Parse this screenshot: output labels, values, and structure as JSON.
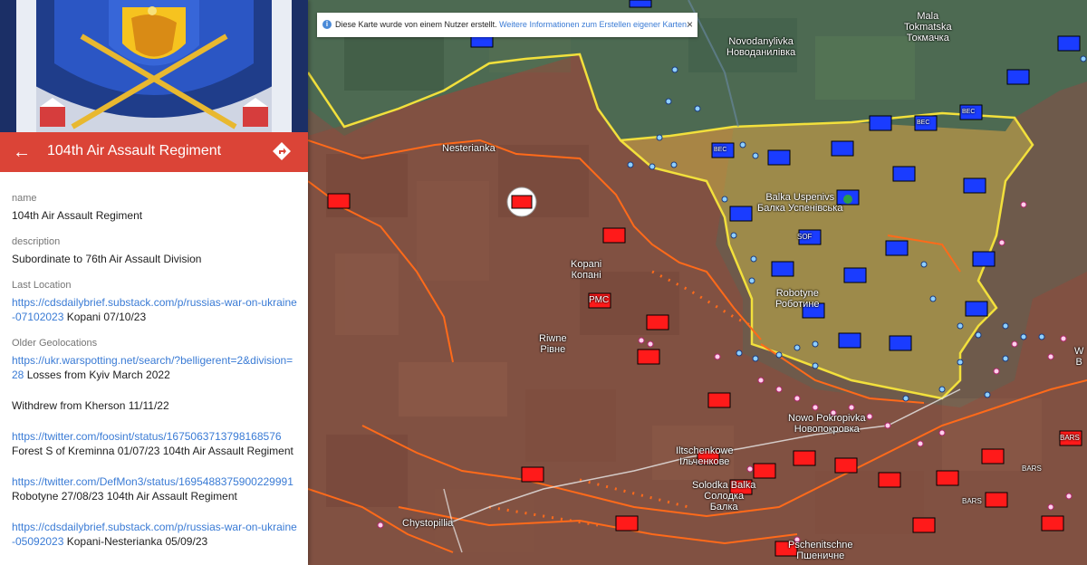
{
  "sidebar": {
    "title": "104th Air Assault Regiment",
    "fields": {
      "name_label": "name",
      "name_value": "104th Air Assault Regiment",
      "description_label": "description",
      "description_value": "Subordinate to 76th Air Assault Division",
      "last_location_label": "Last Location",
      "last_location_link": "https://cdsdailybrief.substack.com/p/russias-war-on-ukraine-07102023",
      "last_location_text": " Kopani 07/10/23",
      "older_geo_label": "Older Geolocations",
      "older_geo_link": "https://ukr.warspotting.net/search/?belligerent=2&division=28",
      "older_geo_text": " Losses from Kyiv March 2022",
      "withdrew_text": "Withdrew from Kherson 11/11/22",
      "twitter1_link": "https://twitter.com/foosint/status/1675063713798168576",
      "twitter1_text": "Forest S of Kreminna 01/07/23 104th Air Assault Regiment",
      "twitter2_link": "https://twitter.com/DefMon3/status/1695488375900229991",
      "twitter2_text": "Robotyne 27/08/23 104th Air Assault Regiment",
      "cds2_link": "https://cdsdailybrief.substack.com/p/russias-war-on-ukraine-05092023",
      "cds2_text": " Kopani-Nesterianka 05/09/23"
    }
  },
  "map": {
    "notice": {
      "text": "Diese Karte wurde von einem Nutzer erstellt.",
      "link": "Weitere Informationen zum Erstellen eigener Karten.",
      "close": "×"
    },
    "places": {
      "mala_tokmatska": "Mala\nTokmatska\nТокмачка",
      "novodanylivka": "Novodanylivka\nНоводанилівка",
      "nesterianka": "Nesterianka",
      "kopani": "Kopani\nКопані",
      "riwne": "Riwne\nРівне",
      "balka": "Balka Uspenivs\nБалка Успенівська",
      "robotyne": "Robotyne\nРоботине",
      "novopokropivka": "Nowo Pokropivka\nНовопокровка",
      "iltschenkowe": "Iltschenkowe\nІльченкове",
      "solodka": "Solodka Balka\nСолодка\nБалка",
      "chystopillia": "Chystopillia",
      "pschenichne": "Pschenitschne\nПшеничне",
      "w_label": "W\nB"
    },
    "unit_labels": {
      "pmc": "PMC",
      "bars": "BARS",
      "sof": "SOF",
      "bec": "BEC"
    },
    "colors": {
      "sidebar_header": "#db4437",
      "link": "#3a7bd5",
      "front_line": "#f2e03c",
      "russian_line": "#ff6a1a",
      "russian_unit": "#ff1a1a",
      "ukrainian_unit": "#1a3cff"
    }
  }
}
